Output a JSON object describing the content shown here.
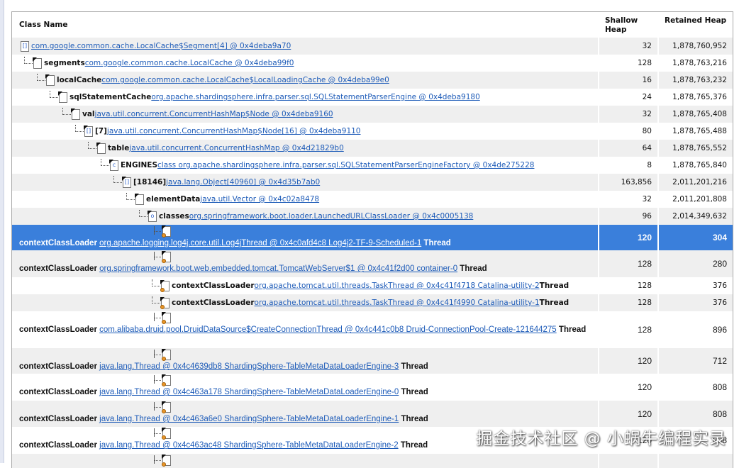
{
  "columns": {
    "class_name": "Class Name",
    "shallow_heap": "Shallow Heap",
    "retained_heap": "Retained Heap"
  },
  "colors": {
    "selected": "#3a7fdb",
    "link": "#1d5bb8",
    "alt_row": "#efefef"
  },
  "rows": [
    {
      "level": 0,
      "icon": "array-icon",
      "field": "",
      "link": "com.google.common.cache.LocalCache$Segment[4] @ 0x4deba9a70",
      "suffix": "",
      "shallow": "32",
      "retained": "1,878,760,952"
    },
    {
      "level": 1,
      "icon": "object-icon",
      "field": "segments",
      "link": "com.google.common.cache.LocalCache @ 0x4deba99f0",
      "suffix": "",
      "shallow": "128",
      "retained": "1,878,763,216"
    },
    {
      "level": 2,
      "icon": "object-icon",
      "field": "localCache",
      "link": "com.google.common.cache.LocalCache$LocalLoadingCache @ 0x4deba99e0",
      "suffix": "",
      "shallow": "16",
      "retained": "1,878,763,232"
    },
    {
      "level": 3,
      "icon": "object-icon",
      "field": "sqlStatementCache",
      "link": "org.apache.shardingsphere.infra.parser.sql.SQLStatementParserEngine @ 0x4deba9180",
      "suffix": "",
      "shallow": "24",
      "retained": "1,878,765,376"
    },
    {
      "level": 4,
      "icon": "object-icon",
      "field": "val",
      "link": "java.util.concurrent.ConcurrentHashMap$Node @ 0x4deba9160",
      "suffix": "",
      "shallow": "32",
      "retained": "1,878,765,408"
    },
    {
      "level": 5,
      "icon": "array-icon",
      "field": "[7]",
      "link": "java.util.concurrent.ConcurrentHashMap$Node[16] @ 0x4deba9110",
      "suffix": "",
      "shallow": "80",
      "retained": "1,878,765,488"
    },
    {
      "level": 6,
      "icon": "object-icon",
      "field": "table",
      "link": "java.util.concurrent.ConcurrentHashMap @ 0x4d21829b0",
      "suffix": "",
      "shallow": "64",
      "retained": "1,878,765,552"
    },
    {
      "level": 7,
      "icon": "class-icon",
      "field": "ENGINES",
      "link": "class org.apache.shardingsphere.infra.parser.sql.SQLStatementParserEngineFactory @ 0x4de275228",
      "suffix": "",
      "shallow": "8",
      "retained": "1,878,765,840"
    },
    {
      "level": 8,
      "icon": "array-icon",
      "field": "[18146]",
      "link": "java.lang.Object[40960] @ 0x4d35b7ab0",
      "suffix": "",
      "shallow": "163,856",
      "retained": "2,011,201,216"
    },
    {
      "level": 9,
      "icon": "object-icon",
      "field": "elementData",
      "link": "java.util.Vector @ 0x4c02a8478",
      "suffix": "",
      "shallow": "32",
      "retained": "2,011,201,808"
    },
    {
      "level": 10,
      "icon": "classloader-icon",
      "field": "classes",
      "link": "org.springframework.boot.loader.LaunchedURLClassLoader @ 0x4c0005138",
      "suffix": "",
      "shallow": "96",
      "retained": "2,014,349,632"
    },
    {
      "tall": true,
      "selected": true,
      "field": "contextClassLoader",
      "link": "org.apache.logging.log4j.core.util.Log4jThread @ 0x4c0afd4c8 Log4j2-TF-9-Scheduled-1",
      "suffix": "Thread",
      "shallow": "120",
      "retained": "304"
    },
    {
      "tall": true,
      "field": "contextClassLoader",
      "link": "org.springframework.boot.web.embedded.tomcat.TomcatWebServer$1 @ 0x4c41f2d00 container-0",
      "suffix": "Thread",
      "shallow": "128",
      "retained": "280"
    },
    {
      "inline": true,
      "field": "contextClassLoader",
      "link": "org.apache.tomcat.util.threads.TaskThread @ 0x4c41f4718 Catalina-utility-2",
      "suffix": "Thread",
      "shallow": "128",
      "retained": "376"
    },
    {
      "inline": true,
      "field": "contextClassLoader",
      "link": "org.apache.tomcat.util.threads.TaskThread @ 0x4c41f4990 Catalina-utility-1",
      "suffix": "Thread",
      "shallow": "128",
      "retained": "376"
    },
    {
      "tall": true,
      "field": "contextClassLoader",
      "link": "com.alibaba.druid.pool.DruidDataSource$CreateConnectionThread @ 0x4c441c0b8 Druid-ConnectionPool-Create-121644275",
      "suffix": "Thread",
      "shallow": "128",
      "retained": "896"
    },
    {
      "tall": true,
      "field": "contextClassLoader",
      "link": "java.lang.Thread @ 0x4c4639db8 ShardingSphere-TableMetaDataLoaderEngine-3",
      "suffix": "Thread",
      "shallow": "120",
      "retained": "712"
    },
    {
      "tall": true,
      "field": "contextClassLoader",
      "link": "java.lang.Thread @ 0x4c463a178 ShardingSphere-TableMetaDataLoaderEngine-0",
      "suffix": "Thread",
      "shallow": "120",
      "retained": "808"
    },
    {
      "tall": true,
      "field": "contextClassLoader",
      "link": "java.lang.Thread @ 0x4c463a6e0 ShardingSphere-TableMetaDataLoaderEngine-1",
      "suffix": "Thread",
      "shallow": "120",
      "retained": "808"
    },
    {
      "tall": true,
      "field": "contextClassLoader",
      "link": "java.lang.Thread @ 0x4c463ac48 ShardingSphere-TableMetaDataLoaderEngine-2",
      "suffix": "Thread",
      "shallow": "120",
      "retained": "808"
    },
    {
      "tall": true,
      "partial": true,
      "field": "",
      "link": "",
      "suffix": "",
      "shallow": "",
      "retained": ""
    }
  ],
  "watermark": "掘金技术社区 @ 小蜗牛编程实录"
}
